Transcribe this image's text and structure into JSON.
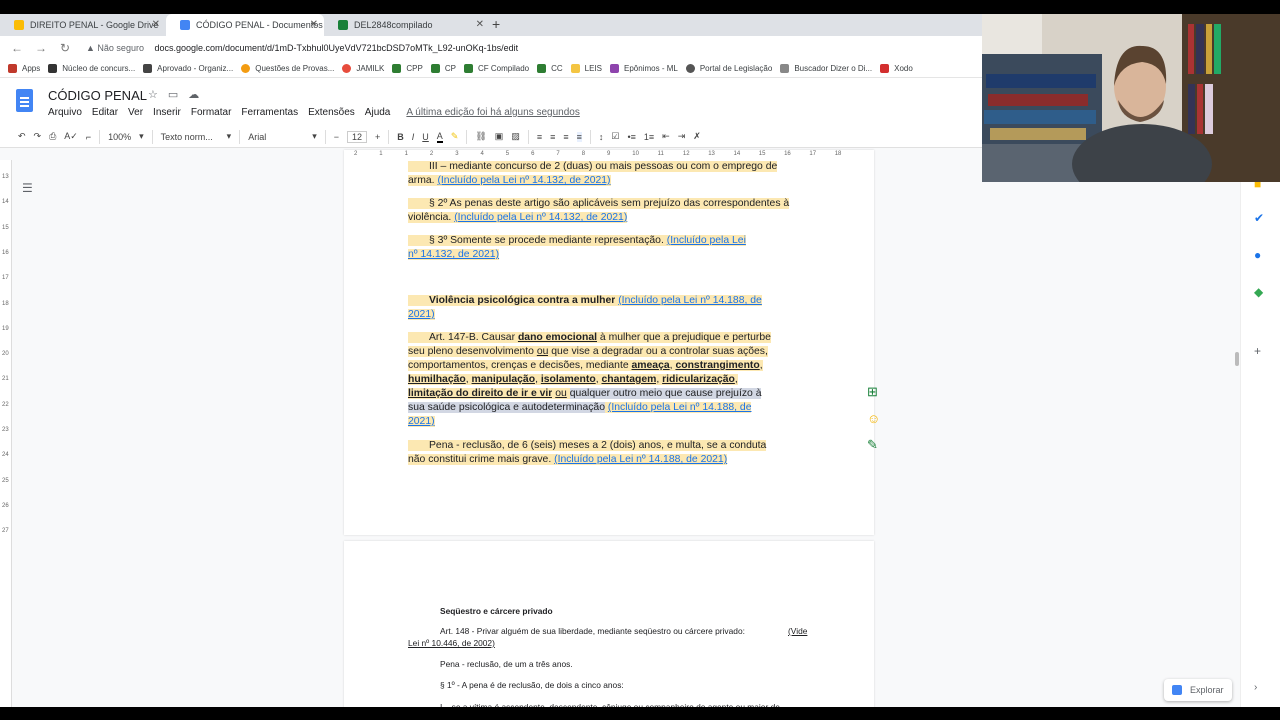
{
  "tabs": [
    {
      "label": "DIREITO PENAL - Google Drive",
      "color": "#fbbc04"
    },
    {
      "label": "CÓDIGO PENAL - Documentos G",
      "color": "#4285f4"
    },
    {
      "label": "DEL2848compilado",
      "color": "#188038"
    }
  ],
  "address": {
    "security": "Não seguro",
    "url": "docs.google.com/document/d/1mD-Txbhul0UyeVdV721bcDSD7oMTk_L92-unOKq-1bs/edit"
  },
  "bookmarks": [
    "Apps",
    "Núcleo de concurs...",
    "Aprovado - Organiz...",
    "Questões de Provas...",
    "JAMILK",
    "CPP",
    "CP",
    "CF Compilado",
    "CC",
    "LEIS",
    "Epônimos - ML",
    "Portal de Legislação",
    "Buscador Dizer o Di...",
    "Xodo"
  ],
  "doc": {
    "title": "CÓDIGO PENAL",
    "menus": [
      "Arquivo",
      "Editar",
      "Ver",
      "Inserir",
      "Formatar",
      "Ferramentas",
      "Extensões",
      "Ajuda"
    ],
    "last_edit": "A última edição foi há alguns segundos"
  },
  "toolbar": {
    "zoom": "100%",
    "style": "Texto norm...",
    "font": "Arial",
    "size": "12"
  },
  "ruler": [
    "2",
    "1",
    "1",
    "2",
    "3",
    "4",
    "5",
    "6",
    "7",
    "8",
    "9",
    "10",
    "11",
    "12",
    "13",
    "14",
    "15",
    "16",
    "17",
    "18"
  ],
  "vruler": [
    "13",
    "14",
    "15",
    "16",
    "17",
    "18",
    "19",
    "20",
    "21",
    "22",
    "23",
    "24",
    "25",
    "26",
    "27"
  ],
  "page1": {
    "l1a": "III – mediante concurso de 2 (duas) ou mais pessoas ou com o emprego de",
    "l1b": "arma.",
    "l1c": "(Incluído pela Lei nº 14.132, de 2021)",
    "l2a": "§ 2º  As penas deste artigo são aplicáveis sem prejuízo das correspondentes à",
    "l2b": "violência.",
    "l2c": "(Incluído pela Lei nº 14.132, de 2021)",
    "l3a": "§ 3º  Somente se procede mediante representação.",
    "l3b": "(Incluído pela Lei",
    "l3c": "nº 14.132, de 2021)",
    "h1": "Violência psicológica contra a mulher",
    "h1b": "(Incluído pela Lei nº 14.188, de",
    "h1c": "2021)",
    "a1": "Art. 147-B. Causar ",
    "a1b": "dano emocional",
    "a1c": " à mulher que a prejudique e perturbe",
    "a2": "seu pleno desenvolvimento ",
    "a2b": "ou",
    "a2c": " que vise a degradar ou a controlar suas ações,",
    "a3": "comportamentos, crenças e decisões, mediante ",
    "a3b": "ameaça",
    "a3c": "constrangimento",
    "a4a": "humilhação",
    "a4b": "manipulação",
    "a4c": "isolamento",
    "a4d": "chantagem",
    "a4e": "ridicularização",
    "a5a": "limitação do direito de ir e vir",
    "a5b": "ou",
    "a5c": "qualquer outro meio que cause prejuízo à",
    "a6a": "sua saúde psicológica e autodeterminação",
    "a6b": "(Incluído pela Lei nº 14.188, de",
    "a7": "2021)",
    "p1": "Pena - reclusão, de 6 (seis) meses a 2 (dois) anos, e multa, se a conduta",
    "p2": "não constitui crime mais grave.",
    "p2b": "(Incluído pela Lei nº 14.188, de 2021)"
  },
  "page2": {
    "heading": "Seqüestro e cárcere privado",
    "art": "Art. 148 - Privar alguém de sua liberdade, mediante seqüestro ou cárcere privado:",
    "vide": "(Vide",
    "vide2": "Lei nº 10.446, de 2002)",
    "pena": "Pena - reclusão, de um a três anos.",
    "par1": "§ 1º - A pena é de reclusão, de dois a cinco anos:",
    "cut": "I – se a vítima é ascendente, descendente, cônjuge ou companheiro do agente ou maior de"
  },
  "explore": "Explorar"
}
